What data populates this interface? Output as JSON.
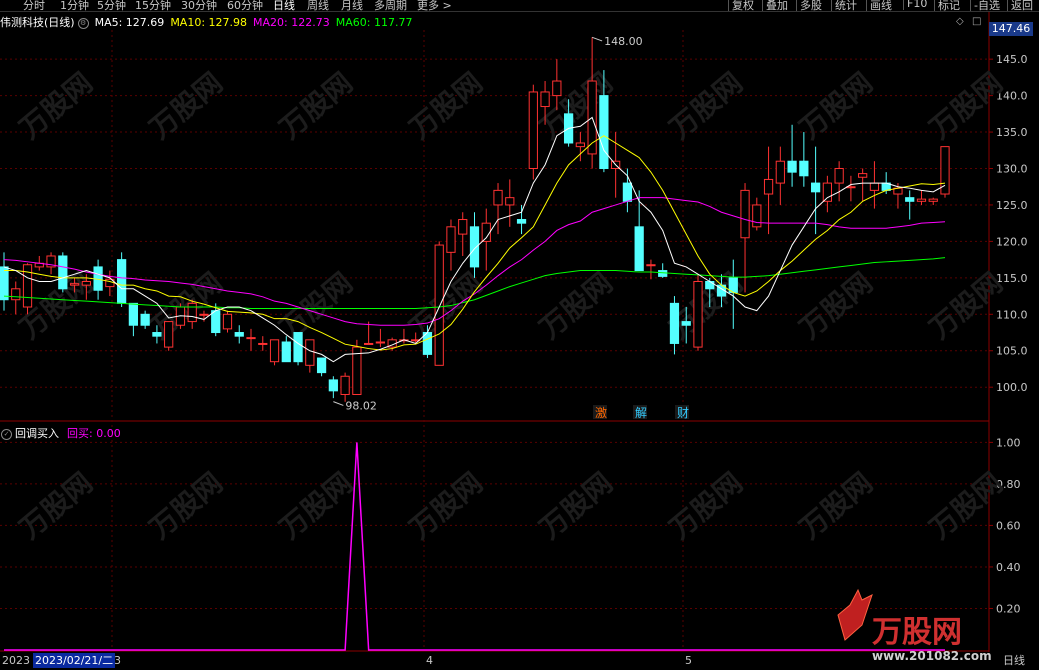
{
  "tabs": [
    "分时",
    "1分钟",
    "5分钟",
    "15分钟",
    "30分钟",
    "60分钟",
    "日线",
    "周线",
    "月线",
    "多周期",
    "更多 >"
  ],
  "active_tab": "日线",
  "right_tabs": [
    "复权",
    "叠加",
    "多股",
    "统计",
    "画线",
    "F10",
    "标记",
    "-自选",
    "返回"
  ],
  "stock_title": "伟测科技(日线)",
  "ma": {
    "ma5": {
      "label": "MA5: 127.69",
      "color": "#ffffff"
    },
    "ma10": {
      "label": "MA10: 127.98",
      "color": "#ffff00"
    },
    "ma20": {
      "label": "MA20: 122.73",
      "color": "#ff00ff"
    },
    "ma60": {
      "label": "MA60: 117.77",
      "color": "#00ff00"
    }
  },
  "current_price": "147.46",
  "annotations": {
    "high": "148.00",
    "low": "98.02"
  },
  "event_tags": [
    {
      "text": "激",
      "color": "#ff6600"
    },
    {
      "text": "解",
      "color": "#33ccff"
    },
    {
      "text": "财",
      "color": "#33ccff"
    }
  ],
  "indicator": {
    "name": "回调买入",
    "value_label": "回买: 0.00",
    "value_color": "#ff00ff"
  },
  "bottom": {
    "date": "2023/02/21/二",
    "left_label": "2023",
    "months": [
      "3",
      "4",
      "5"
    ],
    "period_label": "日线"
  },
  "watermark": {
    "brand": "万股网",
    "url": "www.201082.com"
  },
  "chart_data": {
    "type": "candlestick",
    "price_axis": {
      "ticks": [
        100,
        105,
        110,
        115,
        120,
        125,
        130,
        135,
        140,
        145
      ],
      "ylim": [
        95.5,
        149
      ]
    },
    "indicator_axis": {
      "ticks": [
        "1.00",
        "0.80",
        "0.60",
        "0.40",
        "0.20"
      ],
      "ylim": [
        0,
        1.05
      ]
    },
    "candles": [
      {
        "o": 116.5,
        "h": 118.5,
        "l": 110.5,
        "c": 112
      },
      {
        "o": 112,
        "h": 114.5,
        "l": 110,
        "c": 113.5
      },
      {
        "o": 111,
        "h": 117,
        "l": 110,
        "c": 116.8
      },
      {
        "o": 116.5,
        "h": 118,
        "l": 116,
        "c": 117
      },
      {
        "o": 116.5,
        "h": 118.5,
        "l": 115.5,
        "c": 118
      },
      {
        "o": 118,
        "h": 118.5,
        "l": 113,
        "c": 113.5
      },
      {
        "o": 114,
        "h": 115,
        "l": 113,
        "c": 114.2
      },
      {
        "o": 114,
        "h": 115.5,
        "l": 112,
        "c": 114.5
      },
      {
        "o": 116.5,
        "h": 117.5,
        "l": 112,
        "c": 113.3
      },
      {
        "o": 113.8,
        "h": 116,
        "l": 112.5,
        "c": 114.8
      },
      {
        "o": 117.5,
        "h": 118.5,
        "l": 111,
        "c": 111.5
      },
      {
        "o": 111.5,
        "h": 111.5,
        "l": 107,
        "c": 108.5
      },
      {
        "o": 110,
        "h": 110.5,
        "l": 108,
        "c": 108.5
      },
      {
        "o": 107.5,
        "h": 108.5,
        "l": 106,
        "c": 107
      },
      {
        "o": 105.5,
        "h": 109,
        "l": 105,
        "c": 109
      },
      {
        "o": 108.5,
        "h": 111.5,
        "l": 108,
        "c": 111
      },
      {
        "o": 109,
        "h": 112,
        "l": 108,
        "c": 111.5
      },
      {
        "o": 110,
        "h": 110.5,
        "l": 109,
        "c": 110
      },
      {
        "o": 110.5,
        "h": 111.5,
        "l": 107,
        "c": 107.5
      },
      {
        "o": 108,
        "h": 110.5,
        "l": 107.5,
        "c": 110
      },
      {
        "o": 107.5,
        "h": 108.5,
        "l": 106,
        "c": 107
      },
      {
        "o": 106.8,
        "h": 108,
        "l": 105,
        "c": 106.8
      },
      {
        "o": 106,
        "h": 107,
        "l": 105,
        "c": 106
      },
      {
        "o": 103.5,
        "h": 106,
        "l": 103,
        "c": 106.5
      },
      {
        "o": 106.2,
        "h": 107,
        "l": 103.5,
        "c": 103.5
      },
      {
        "o": 107.5,
        "h": 107.5,
        "l": 103,
        "c": 103.5
      },
      {
        "o": 103,
        "h": 106,
        "l": 102,
        "c": 106.5
      },
      {
        "o": 104,
        "h": 104,
        "l": 101.5,
        "c": 102
      },
      {
        "o": 101,
        "h": 101.5,
        "l": 98.5,
        "c": 99.5
      },
      {
        "o": 99,
        "h": 102,
        "l": 98,
        "c": 101.5
      },
      {
        "o": 99,
        "h": 106.5,
        "l": 99,
        "c": 105.5
      },
      {
        "o": 106,
        "h": 109,
        "l": 106,
        "c": 106
      },
      {
        "o": 106.2,
        "h": 108,
        "l": 105.5,
        "c": 106.2
      },
      {
        "o": 105.5,
        "h": 106.8,
        "l": 105,
        "c": 106.5
      },
      {
        "o": 106.5,
        "h": 108,
        "l": 106,
        "c": 106.5
      },
      {
        "o": 106.5,
        "h": 107.5,
        "l": 106,
        "c": 106.5
      },
      {
        "o": 107.5,
        "h": 108.5,
        "l": 104,
        "c": 104.5
      },
      {
        "o": 103,
        "h": 120,
        "l": 103,
        "c": 119.5
      },
      {
        "o": 118.5,
        "h": 123,
        "l": 116,
        "c": 122
      },
      {
        "o": 121,
        "h": 124,
        "l": 118,
        "c": 123
      },
      {
        "o": 122,
        "h": 124,
        "l": 115,
        "c": 116.5
      },
      {
        "o": 120,
        "h": 124.5,
        "l": 116,
        "c": 122.5
      },
      {
        "o": 125,
        "h": 128,
        "l": 121,
        "c": 127
      },
      {
        "o": 125,
        "h": 128.5,
        "l": 122,
        "c": 126
      },
      {
        "o": 123,
        "h": 125,
        "l": 121,
        "c": 122.5
      },
      {
        "o": 130,
        "h": 141.5,
        "l": 128.5,
        "c": 140.5
      },
      {
        "o": 138.5,
        "h": 142,
        "l": 136,
        "c": 140.5
      },
      {
        "o": 140,
        "h": 145,
        "l": 138,
        "c": 142
      },
      {
        "o": 137.5,
        "h": 139.5,
        "l": 133,
        "c": 133.5
      },
      {
        "o": 133,
        "h": 135,
        "l": 131,
        "c": 133.5
      },
      {
        "o": 132,
        "h": 148,
        "l": 130,
        "c": 142
      },
      {
        "o": 140,
        "h": 143.5,
        "l": 129.5,
        "c": 130
      },
      {
        "o": 130,
        "h": 135,
        "l": 126,
        "c": 131
      },
      {
        "o": 128,
        "h": 130,
        "l": 124,
        "c": 125.5
      },
      {
        "o": 122,
        "h": 127,
        "l": 117,
        "c": 116
      },
      {
        "o": 116.8,
        "h": 117.5,
        "l": 114.8,
        "c": 116.8
      },
      {
        "o": 116,
        "h": 117,
        "l": 115,
        "c": 115.2
      },
      {
        "o": 111.5,
        "h": 112.5,
        "l": 104.5,
        "c": 106
      },
      {
        "o": 109,
        "h": 111,
        "l": 106,
        "c": 108.5
      },
      {
        "o": 105.5,
        "h": 115.5,
        "l": 105,
        "c": 114.5
      },
      {
        "o": 114.5,
        "h": 115,
        "l": 111,
        "c": 113.5
      },
      {
        "o": 114,
        "h": 115.5,
        "l": 111,
        "c": 112.5
      },
      {
        "o": 115,
        "h": 117.5,
        "l": 108,
        "c": 113
      },
      {
        "o": 120.5,
        "h": 128,
        "l": 113,
        "c": 127
      },
      {
        "o": 122,
        "h": 126,
        "l": 121.5,
        "c": 125
      },
      {
        "o": 126.5,
        "h": 133,
        "l": 121,
        "c": 128.5
      },
      {
        "o": 128,
        "h": 133,
        "l": 125,
        "c": 131
      },
      {
        "o": 131,
        "h": 136,
        "l": 127.5,
        "c": 129.5
      },
      {
        "o": 131,
        "h": 135,
        "l": 127.5,
        "c": 129
      },
      {
        "o": 128,
        "h": 133,
        "l": 121,
        "c": 126.8
      },
      {
        "o": 125.5,
        "h": 129,
        "l": 124,
        "c": 128
      },
      {
        "o": 128,
        "h": 131,
        "l": 125.5,
        "c": 130
      },
      {
        "o": 127.5,
        "h": 129,
        "l": 125.5,
        "c": 127.5
      },
      {
        "o": 128.8,
        "h": 130,
        "l": 125.5,
        "c": 129.3
      },
      {
        "o": 127,
        "h": 131,
        "l": 124.5,
        "c": 128
      },
      {
        "o": 128,
        "h": 129.5,
        "l": 126.5,
        "c": 127
      },
      {
        "o": 126.5,
        "h": 128,
        "l": 124.5,
        "c": 127.3
      },
      {
        "o": 126,
        "h": 127,
        "l": 123,
        "c": 125.5
      },
      {
        "o": 125.5,
        "h": 127,
        "l": 125,
        "c": 125.8
      },
      {
        "o": 125.5,
        "h": 126,
        "l": 125,
        "c": 125.8
      },
      {
        "o": 126.5,
        "h": 133,
        "l": 126,
        "c": 133
      }
    ],
    "ma5": [
      116.5,
      116,
      115,
      114.5,
      114.5,
      115,
      115.5,
      116,
      115.5,
      115,
      113.5,
      113.5,
      112.5,
      111.5,
      109.5,
      109.8,
      109.7,
      109.3,
      110.5,
      111,
      111,
      110.5,
      109.5,
      108.5,
      107.2,
      106,
      105,
      104.5,
      103.5,
      104.5,
      104.6,
      104.7,
      105.2,
      105.8,
      106.5,
      106,
      107.5,
      111,
      114.5,
      117,
      119,
      120.5,
      123,
      123.5,
      124,
      128,
      130.5,
      134.5,
      135.5,
      135.8,
      137,
      132.5,
      130.5,
      129,
      125.5,
      124,
      121.5,
      117,
      116.5,
      115.5,
      114.5,
      113.5,
      112.5,
      111,
      110.5,
      112.5,
      116,
      119.5,
      122,
      124.5,
      126,
      126.8,
      127.8,
      128,
      128,
      128,
      127.5,
      127.3,
      127,
      126.8,
      127.7
    ],
    "ma10": [
      116,
      116,
      115.8,
      115.5,
      115.2,
      115,
      115,
      115,
      114.8,
      114.5,
      114,
      114,
      113.5,
      113.2,
      112.5,
      112.4,
      111.8,
      111.4,
      110.9,
      110.4,
      110.3,
      110.2,
      110,
      109.4,
      109.4,
      109,
      108.2,
      107.5,
      106.7,
      105.9,
      105.6,
      105.3,
      105.1,
      105.3,
      105.8,
      105.9,
      106.6,
      107.3,
      108.6,
      110.7,
      113.1,
      115.1,
      117,
      119.1,
      120.5,
      122,
      125,
      128,
      130.5,
      132,
      133.5,
      134.5,
      133.5,
      132.5,
      131.5,
      129.5,
      127,
      124,
      121,
      118,
      115.5,
      114,
      113,
      112.5,
      113.2,
      114.5,
      116,
      117.3,
      118.8,
      120.3,
      121.5,
      123,
      124,
      125.5,
      126.3,
      127,
      127.3,
      127.6,
      127.9,
      127.8,
      128
    ],
    "ma20": [
      117.5,
      117.4,
      117.2,
      117,
      116.8,
      116.5,
      116.2,
      115.8,
      115.5,
      115.2,
      115,
      114.9,
      114.7,
      114.6,
      114.5,
      114.3,
      114.1,
      113.8,
      113.5,
      113.2,
      113,
      112.8,
      112.4,
      111.8,
      111.5,
      111,
      110.5,
      110,
      109.5,
      109,
      108.7,
      108.6,
      108.5,
      108.5,
      108.5,
      108.6,
      108.8,
      109.4,
      110.5,
      111.8,
      112.8,
      114,
      115.3,
      116.5,
      117.5,
      118.8,
      120,
      121.5,
      122.3,
      122.8,
      124,
      124.5,
      125,
      125.5,
      126,
      126,
      126,
      125.8,
      125.6,
      125.4,
      124.8,
      124,
      123.5,
      123,
      122.6,
      122.5,
      122.5,
      122.5,
      122.5,
      122.5,
      122.3,
      122,
      121.8,
      121.8,
      121.8,
      121.8,
      122,
      122.2,
      122.5,
      122.6,
      122.7
    ],
    "ma60": [
      112.5,
      112.4,
      112.3,
      112.2,
      112.1,
      112,
      111.9,
      111.8,
      111.7,
      111.6,
      111.5,
      111.4,
      111.3,
      111.2,
      111.1,
      111,
      111,
      111,
      111,
      110.9,
      110.9,
      110.8,
      110.8,
      110.8,
      110.8,
      110.8,
      110.8,
      110.8,
      110.8,
      110.8,
      110.8,
      110.8,
      110.8,
      110.8,
      110.8,
      110.8,
      110.9,
      111,
      111.2,
      111.6,
      112,
      112.6,
      113.2,
      113.8,
      114.3,
      114.8,
      115.3,
      115.6,
      115.8,
      116,
      116,
      116,
      116,
      115.9,
      115.8,
      115.8,
      115.7,
      115.6,
      115.5,
      115.4,
      115.3,
      115.2,
      115.1,
      115.1,
      115.2,
      115.3,
      115.5,
      115.7,
      115.9,
      116.1,
      116.3,
      116.5,
      116.7,
      116.9,
      117.1,
      117.2,
      117.3,
      117.4,
      117.5,
      117.6,
      117.77
    ],
    "signal": [
      0,
      0,
      0,
      0,
      0,
      0,
      0,
      0,
      0,
      0,
      0,
      0,
      0,
      0,
      0,
      0,
      0,
      0,
      0,
      0,
      0,
      0,
      0,
      0,
      0,
      0,
      0,
      0,
      0,
      0,
      0,
      0,
      0,
      0,
      0,
      0,
      0,
      0,
      0,
      0,
      0,
      0,
      0,
      0,
      0,
      0,
      0,
      0,
      0,
      0,
      0,
      0,
      0,
      0,
      0,
      0,
      0,
      0,
      0,
      0,
      0,
      0,
      0,
      0,
      0,
      0,
      0,
      0,
      0,
      0,
      0,
      0,
      0,
      0,
      0,
      0,
      0,
      0,
      0,
      0,
      0
    ],
    "signal_peak": {
      "index": 30,
      "value": 1.0
    }
  }
}
